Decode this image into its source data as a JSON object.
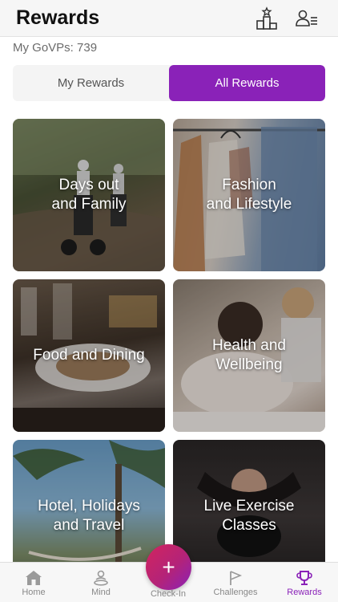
{
  "header": {
    "title": "Rewards",
    "icons": [
      "leaderboard-icon",
      "profile-list-icon"
    ]
  },
  "points": {
    "text": "My GoVPs: 739"
  },
  "segments": {
    "my_rewards": "My Rewards",
    "all_rewards": "All Rewards",
    "selected": "All Rewards"
  },
  "tiles": [
    {
      "label": "Days out\nand Family"
    },
    {
      "label": "Fashion\nand Lifestyle"
    },
    {
      "label": "Food and Dining"
    },
    {
      "label": "Health and\nWellbeing"
    },
    {
      "label": "Hotel, Holidays\nand Travel"
    },
    {
      "label": "Live Exercise\nClasses"
    }
  ],
  "fab": {
    "symbol": "+"
  },
  "tabbar": {
    "items": [
      {
        "label": "Home",
        "icon": "home-icon"
      },
      {
        "label": "Mind",
        "icon": "mind-icon"
      },
      {
        "label": "Check-In",
        "icon": "plus-icon"
      },
      {
        "label": "Challenges",
        "icon": "flag-icon"
      },
      {
        "label": "Rewards",
        "icon": "trophy-icon"
      }
    ],
    "active": "Rewards"
  },
  "colors": {
    "accent": "#8a22b8",
    "fab_start": "#d2255e",
    "inactive": "#888888"
  }
}
